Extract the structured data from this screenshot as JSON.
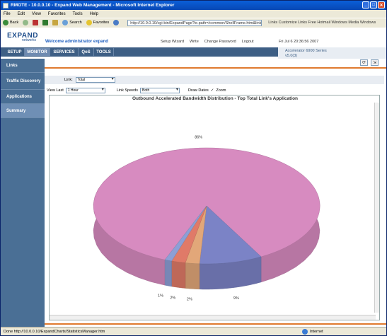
{
  "window": {
    "title": "RMOTE - 10.0.0.10 - Expand Web Management - Microsoft Internet Explorer",
    "min": "_",
    "max": "□",
    "close": "✕"
  },
  "menu": [
    "File",
    "Edit",
    "View",
    "Favorites",
    "Tools",
    "Help"
  ],
  "toolbar": {
    "back": "Back",
    "search": "Search",
    "favorites": "Favorites",
    "address": "http://10.0.0.10/cgi-bin/ExpandPage?ie.path=/common/ShellFrame.htm&link=/NetworkFrame.htm",
    "links_strip": "Links  Customize Links  Free Hotmail  Windows Media  Windows"
  },
  "header": {
    "logo": "EXPAND",
    "logo_sub": "networks",
    "welcome": "Welcome administrator expand",
    "links": [
      "Setup Wizard",
      "Write",
      "Change Password",
      "Logout"
    ],
    "datetime": "Fri Jul 6 20:36:56 2007",
    "accel_line1": "Accelerator 6900 Series",
    "accel_line2": "v5.0(3)"
  },
  "nav": [
    "SETUP",
    "MONITOR",
    "SERVICES",
    "QoS",
    "TOOLS"
  ],
  "sidebar": [
    "Links",
    "Traffic Discovery",
    "Applications",
    "Summary"
  ],
  "controls": {
    "link_label": "Link:",
    "link_value": "Total",
    "view_last_label": "View Last",
    "view_last_value": "1 Hour",
    "link_speeds_label": "Link Speeds",
    "link_speeds_value": "Both",
    "draw_dates_label": "Draw Dates",
    "zoom_label": "Zoom"
  },
  "status": {
    "text": "Done http://10.0.0.10/ExpandCharts/StatisticsManager.htm",
    "zone": "Internet"
  },
  "chart_data": {
    "type": "pie",
    "title": "Outbound Accelerated Bandwidth Distribution - Top Total Link's Application",
    "categories": [
      "",
      "",
      "",
      "",
      ""
    ],
    "values": [
      86,
      9,
      2,
      2,
      1
    ],
    "slice_labels": [
      "86%",
      "9%",
      "2%",
      "2%",
      "1%"
    ],
    "colors": [
      "#d78bc0",
      "#7b83c6",
      "#e2a779",
      "#e07a68",
      "#8c9fd6"
    ]
  }
}
